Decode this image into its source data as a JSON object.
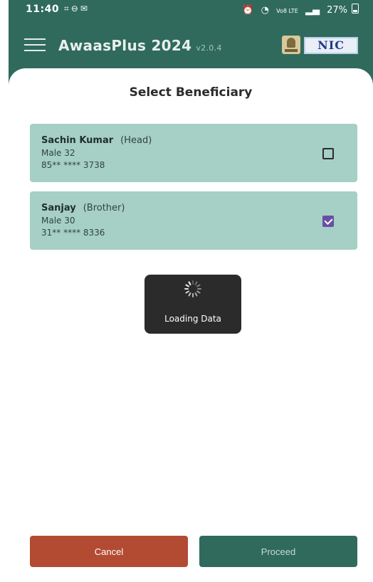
{
  "status_bar": {
    "time": "11:40",
    "left_icons": [
      "screenshot-icon",
      "dnd-icon",
      "message-icon"
    ],
    "right_icons": [
      "alarm-icon",
      "wifi-icon",
      "volte-icon",
      "signal-icon"
    ],
    "network_label": "Vo8 LTE",
    "battery": "27%"
  },
  "app_bar": {
    "title": "AwaasPlus 2024",
    "version": "v2.0.4",
    "logo_text": "NIC",
    "menu_icon": "hamburger-menu-icon",
    "emblem_icon": "national-emblem-icon"
  },
  "page": {
    "title": "Select Beneficiary"
  },
  "beneficiaries": [
    {
      "name": "Sachin Kumar",
      "relation": "(Head)",
      "gender_age": "Male  32",
      "phone": "85** **** 3738",
      "checked": false
    },
    {
      "name": "Sanjay",
      "relation": "(Brother)",
      "gender_age": "Male  30",
      "phone": "31** **** 8336",
      "checked": true
    }
  ],
  "loading": {
    "text": "Loading Data",
    "icon": "spinner-icon"
  },
  "actions": {
    "cancel_label": "Cancel",
    "proceed_label": "Proceed"
  },
  "colors": {
    "primary": "#2f6a5d",
    "card": "#a6cfc5",
    "cancel": "#b34a32",
    "checkbox_checked": "#6750a4"
  }
}
